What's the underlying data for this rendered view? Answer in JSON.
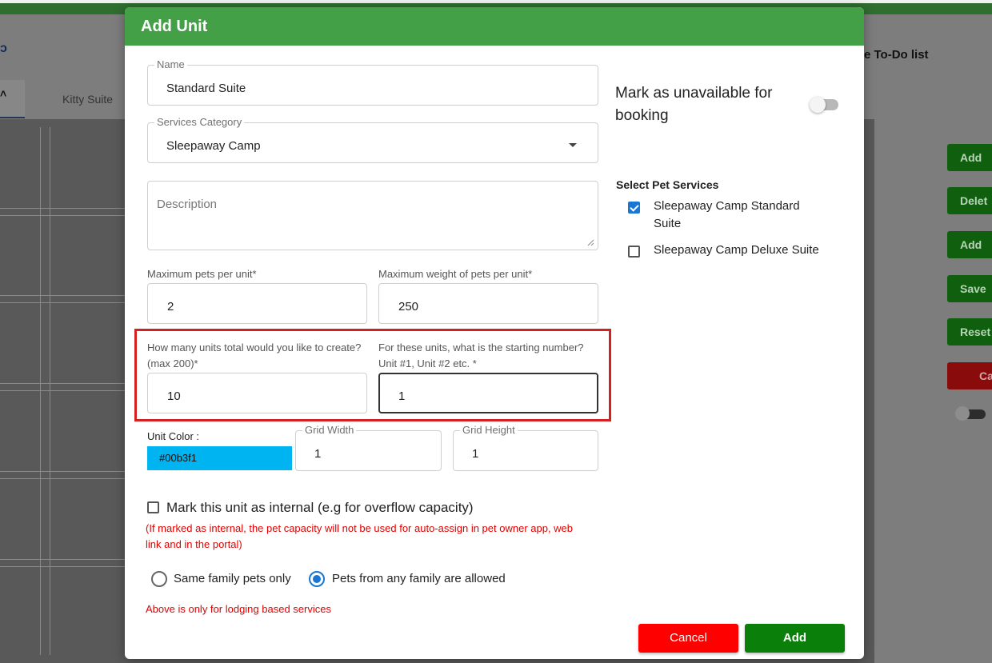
{
  "background": {
    "left_glyph": "ɔ",
    "active_tab_glyph": "˄",
    "tab_label": "Kitty Suite",
    "todo_text": "e To-Do list",
    "side_buttons": [
      "Add",
      "Delet",
      "Add",
      "Save",
      "Reset",
      "Ca"
    ]
  },
  "modal": {
    "title": "Add Unit",
    "name_field": {
      "legend": "Name",
      "value": "Standard Suite"
    },
    "category_field": {
      "legend": "Services Category",
      "value": "Sleepaway Camp"
    },
    "description_field": {
      "placeholder": "Description",
      "value": ""
    },
    "max_pets": {
      "label": "Maximum pets per unit*",
      "value": "2"
    },
    "max_weight": {
      "label": "Maximum weight of pets per unit*",
      "value": "250"
    },
    "units_total": {
      "label_line1": "How many units total would you like to create?",
      "label_line2": "(max 200)*",
      "value": "10"
    },
    "starting_number": {
      "label_line1": "For these units, what is the starting number?",
      "label_line2": "Unit #1, Unit #2 etc. *",
      "value": "1"
    },
    "unit_color": {
      "label": "Unit Color :",
      "value": "#00b3f1"
    },
    "grid_width": {
      "legend": "Grid Width",
      "value": "1"
    },
    "grid_height": {
      "legend": "Grid Height",
      "value": "1"
    },
    "internal": {
      "label": "Mark this unit as internal (e.g for overflow capacity)",
      "checked": false,
      "note_line1": "(If marked as internal, the pet capacity will not be used for auto-assign in pet owner app, web",
      "note_line2": "link and in the portal)"
    },
    "family_options": [
      {
        "label": "Same family pets only",
        "selected": false
      },
      {
        "label": "Pets from any family are allowed",
        "selected": true
      }
    ],
    "lodging_note": "Above is only for lodging based services",
    "unavailable": {
      "label": "Mark as unavailable for booking",
      "on": false
    },
    "pet_services": {
      "title": "Select Pet Services",
      "items": [
        {
          "label": "Sleepaway Camp Standard Suite",
          "checked": true
        },
        {
          "label": "Sleepaway Camp Deluxe Suite",
          "checked": false
        }
      ]
    },
    "buttons": {
      "cancel": "Cancel",
      "add": "Add"
    }
  },
  "colors": {
    "header_green": "#43a047",
    "add_button": "#0a7f0a",
    "cancel_button": "#ff0000",
    "highlight_border": "#d62020",
    "unit_color_swatch": "#00b3f1",
    "checkbox_blue": "#1976d2"
  }
}
